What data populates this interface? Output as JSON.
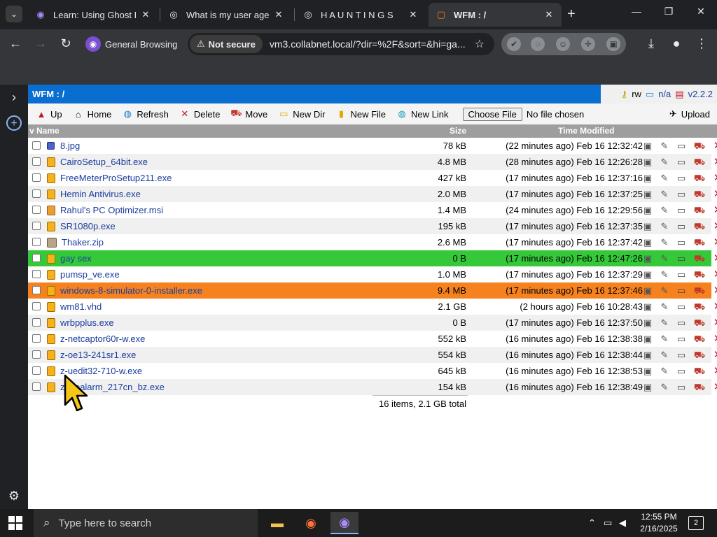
{
  "browser": {
    "tabs": [
      {
        "title": "Learn: Using Ghost Bro",
        "favicon": "ghost-icon"
      },
      {
        "title": "What is my user agent",
        "favicon": "globe-icon"
      },
      {
        "title": "H A U N T I N G S",
        "favicon": "globe-icon"
      },
      {
        "title": "WFM : /",
        "favicon": "page-icon"
      }
    ],
    "new_tab": "+",
    "profile_label": "General Browsing",
    "security_label": "Not secure",
    "url": "vm3.collabnet.local/?dir=%2F&sort=&hi=ga..."
  },
  "wfm": {
    "title": "WFM : /",
    "mode": "rw",
    "info": "n/a",
    "version": "v2.2.2",
    "actions": {
      "up": "Up",
      "home": "Home",
      "refresh": "Refresh",
      "delete": "Delete",
      "move": "Move",
      "new_dir": "New Dir",
      "new_file": "New File",
      "new_link": "New Link",
      "choose_file": "Choose File",
      "no_file": "No file chosen",
      "upload": "Upload"
    },
    "columns": {
      "name": "v Name",
      "size": "Size",
      "time": "Time Modified"
    },
    "files": [
      {
        "name": "8.jpg",
        "size": "78 kB",
        "time": "(22 minutes ago) Feb 16 12:32:42",
        "type": "img"
      },
      {
        "name": "CairoSetup_64bit.exe",
        "size": "4.8 MB",
        "time": "(28 minutes ago) Feb 16 12:26:28",
        "type": "exe"
      },
      {
        "name": "FreeMeterProSetup211.exe",
        "size": "427 kB",
        "time": "(17 minutes ago) Feb 16 12:37:16",
        "type": "exe"
      },
      {
        "name": "Hemin Antivirus.exe",
        "size": "2.0 MB",
        "time": "(17 minutes ago) Feb 16 12:37:25",
        "type": "exe"
      },
      {
        "name": "Rahul's PC Optimizer.msi",
        "size": "1.4 MB",
        "time": "(24 minutes ago) Feb 16 12:29:56",
        "type": "msi"
      },
      {
        "name": "SR1080p.exe",
        "size": "195 kB",
        "time": "(17 minutes ago) Feb 16 12:37:35",
        "type": "exe"
      },
      {
        "name": "Thaker.zip",
        "size": "2.6 MB",
        "time": "(17 minutes ago) Feb 16 12:37:42",
        "type": "zip"
      },
      {
        "name": "gay sex",
        "size": "0 B",
        "time": "(17 minutes ago) Feb 16 12:47:26",
        "type": "exe"
      },
      {
        "name": "pumsp_ve.exe",
        "size": "1.0 MB",
        "time": "(17 minutes ago) Feb 16 12:37:29",
        "type": "exe"
      },
      {
        "name": "windows-8-simulator-0-installer.exe",
        "size": "9.4 MB",
        "time": "(17 minutes ago) Feb 16 12:37:46",
        "type": "exe"
      },
      {
        "name": "wm81.vhd",
        "size": "2.1 GB",
        "time": "(2 hours ago) Feb 16 10:28:43",
        "type": "exe"
      },
      {
        "name": "wrbpplus.exe",
        "size": "0 B",
        "time": "(17 minutes ago) Feb 16 12:37:50",
        "type": "exe"
      },
      {
        "name": "z-netcaptor60r-w.exe",
        "size": "552 kB",
        "time": "(16 minutes ago) Feb 16 12:38:38",
        "type": "exe"
      },
      {
        "name": "z-oe13-241sr1.exe",
        "size": "554 kB",
        "time": "(16 minutes ago) Feb 16 12:38:44",
        "type": "exe"
      },
      {
        "name": "z-uedit32-710-w.exe",
        "size": "645 kB",
        "time": "(16 minutes ago) Feb 16 12:38:53",
        "type": "exe"
      },
      {
        "name": "zonealarm_217cn_bz.exe",
        "size": "154 kB",
        "time": "(16 minutes ago) Feb 16 12:38:49",
        "type": "exe"
      }
    ],
    "highlight_green_index": 7,
    "highlight_orange_index": 9,
    "colors": {
      "header": "#0a6ed1",
      "green": "#35c93a",
      "orange": "#f5821f",
      "link": "#1a3d9e"
    },
    "total": "16 items, 2.1 GB total"
  },
  "taskbar": {
    "search_placeholder": "Type here to search",
    "time": "12:55 PM",
    "date": "2/16/2025",
    "notifications": "2"
  }
}
